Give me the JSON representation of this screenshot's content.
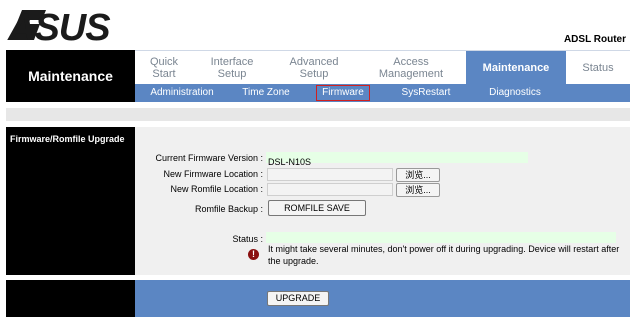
{
  "header": {
    "logo_text": "ASUS",
    "product": "ADSL Router"
  },
  "left": {
    "section": "Maintenance",
    "panel_title": "Firmware/Romfile Upgrade"
  },
  "menu": [
    {
      "line1": "Quick",
      "line2": "Start"
    },
    {
      "line1": "Interface",
      "line2": "Setup"
    },
    {
      "line1": "Advanced",
      "line2": "Setup"
    },
    {
      "line1": "Access",
      "line2": "Management"
    },
    {
      "line1": "Maintenance",
      "line2": ""
    },
    {
      "line1": "Status",
      "line2": ""
    }
  ],
  "submenu": [
    "Administration",
    "Time Zone",
    "Firmware",
    "SysRestart",
    "Diagnostics"
  ],
  "form": {
    "current_fw_label": "Current Firmware Version :",
    "current_fw_value": "DSL-N10S",
    "new_fw_label": "New Firmware Location :",
    "new_romfile_label": "New Romfile Location :",
    "browse_label": "浏览...",
    "backup_label": "Romfile Backup :",
    "backup_button": "ROMFILE SAVE",
    "status_label": "Status :",
    "status_value": "",
    "warning": "It might take several minutes, don't power off it during upgrading. Device will restart after the upgrade.",
    "upgrade_button": "UPGRADE"
  },
  "colors": {
    "accent": "#5b86c3",
    "dark": "#000000",
    "highlight_border": "#d02020",
    "value_bg": "#e6ffe6",
    "warning_icon": "#8a0f0f"
  }
}
